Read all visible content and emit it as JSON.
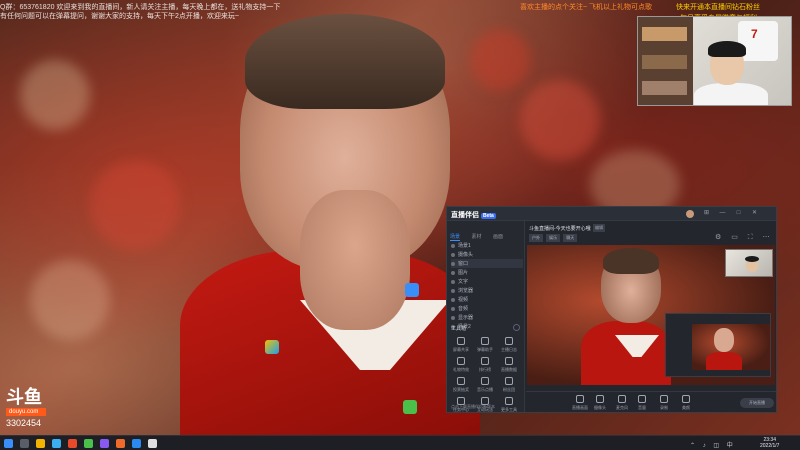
{
  "overlay": {
    "notice_line1": "Q群：653761820  欢迎来到我的直播间，新人请关注主播，每天晚上都在，送礼物支持一下",
    "notice_line2": "有任何问题可以在弹幕提问，谢谢大家的支持，每天下午2点开播，欢迎来玩~",
    "notice_right_top": "喜欢主播的点个关注~ 飞机以上礼物可点歌",
    "notice_right_1": "快来开通本直播间钻石粉丝",
    "notice_right_2": "每月享受专属徽章与福利"
  },
  "webcam": {
    "shirt_number": "7"
  },
  "logo": {
    "mark": "斗鱼",
    "domain": "douyu.com",
    "room_id": "3302454"
  },
  "app": {
    "name": "直播伴侣",
    "badge": "Beta",
    "window_controls": [
      "⊞",
      "—",
      "□",
      "✕"
    ],
    "left_tabs": [
      "场景",
      "素材",
      "画面"
    ],
    "scenes": [
      "场景1",
      "摄像头",
      "窗口",
      "图片",
      "文字",
      "浏览器",
      "视频",
      "音频",
      "显示器",
      "场景2"
    ],
    "tools_header": "工具箱",
    "tools": [
      "屏幕共享",
      "弹幕助手",
      "主播日志",
      "礼物特效",
      "排行榜",
      "直播数据",
      "投票抽奖",
      "音乐点播",
      "粉丝团",
      "任务中心",
      "互动玩法",
      "更多工具"
    ],
    "left_footer": "点击下载直播伴侣新版本",
    "room_title": "斗鱼直播间-今天也要开心哦",
    "edit_label": "编辑",
    "tags": [
      "户外",
      "娱乐",
      "聊天"
    ],
    "main_icons": "⚙ ▭ ⛶ ⋯",
    "controls": [
      "直播画面",
      "摄像头",
      "麦克风",
      "音量",
      "录制",
      "美颜"
    ],
    "go_live_label": "开始直播"
  },
  "taskbar": {
    "tray": "⌃ ♪ ◫ 中",
    "time": "23:34",
    "date": "2022/1/7"
  }
}
